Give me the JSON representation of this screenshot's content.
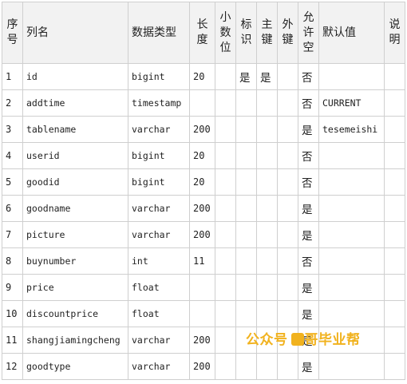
{
  "headers": [
    "序号",
    "列名",
    "数据类型",
    "长度",
    "小数位",
    "标识",
    "主键",
    "外键",
    "允许空",
    "默认值",
    "说明"
  ],
  "rows": [
    {
      "seq": "1",
      "name": "id",
      "type": "bigint",
      "length": "20",
      "scale": "",
      "identity": "是",
      "pk": "是",
      "fk": "",
      "nullable": "否",
      "default": "",
      "desc": ""
    },
    {
      "seq": "2",
      "name": "addtime",
      "type": "timestamp",
      "length": "",
      "scale": "",
      "identity": "",
      "pk": "",
      "fk": "",
      "nullable": "否",
      "default": "CURRENT",
      "desc": ""
    },
    {
      "seq": "3",
      "name": "tablename",
      "type": "varchar",
      "length": "200",
      "scale": "",
      "identity": "",
      "pk": "",
      "fk": "",
      "nullable": "是",
      "default": "tesemeishi",
      "desc": ""
    },
    {
      "seq": "4",
      "name": "userid",
      "type": "bigint",
      "length": "20",
      "scale": "",
      "identity": "",
      "pk": "",
      "fk": "",
      "nullable": "否",
      "default": "",
      "desc": ""
    },
    {
      "seq": "5",
      "name": "goodid",
      "type": "bigint",
      "length": "20",
      "scale": "",
      "identity": "",
      "pk": "",
      "fk": "",
      "nullable": "否",
      "default": "",
      "desc": ""
    },
    {
      "seq": "6",
      "name": "goodname",
      "type": "varchar",
      "length": "200",
      "scale": "",
      "identity": "",
      "pk": "",
      "fk": "",
      "nullable": "是",
      "default": "",
      "desc": ""
    },
    {
      "seq": "7",
      "name": "picture",
      "type": "varchar",
      "length": "200",
      "scale": "",
      "identity": "",
      "pk": "",
      "fk": "",
      "nullable": "是",
      "default": "",
      "desc": ""
    },
    {
      "seq": "8",
      "name": "buynumber",
      "type": "int",
      "length": "11",
      "scale": "",
      "identity": "",
      "pk": "",
      "fk": "",
      "nullable": "否",
      "default": "",
      "desc": ""
    },
    {
      "seq": "9",
      "name": "price",
      "type": "float",
      "length": "",
      "scale": "",
      "identity": "",
      "pk": "",
      "fk": "",
      "nullable": "是",
      "default": "",
      "desc": ""
    },
    {
      "seq": "10",
      "name": "discountprice",
      "type": "float",
      "length": "",
      "scale": "",
      "identity": "",
      "pk": "",
      "fk": "",
      "nullable": "是",
      "default": "",
      "desc": ""
    },
    {
      "seq": "11",
      "name": "shangjiamingcheng",
      "type": "varchar",
      "length": "200",
      "scale": "",
      "identity": "",
      "pk": "",
      "fk": "",
      "nullable": "是",
      "default": "",
      "desc": ""
    },
    {
      "seq": "12",
      "name": "goodtype",
      "type": "varchar",
      "length": "200",
      "scale": "",
      "identity": "",
      "pk": "",
      "fk": "",
      "nullable": "是",
      "default": "",
      "desc": ""
    }
  ],
  "watermark": {
    "text_left": "公众号",
    "text_right": "哥毕业帮",
    "color": "#f1b21e"
  }
}
